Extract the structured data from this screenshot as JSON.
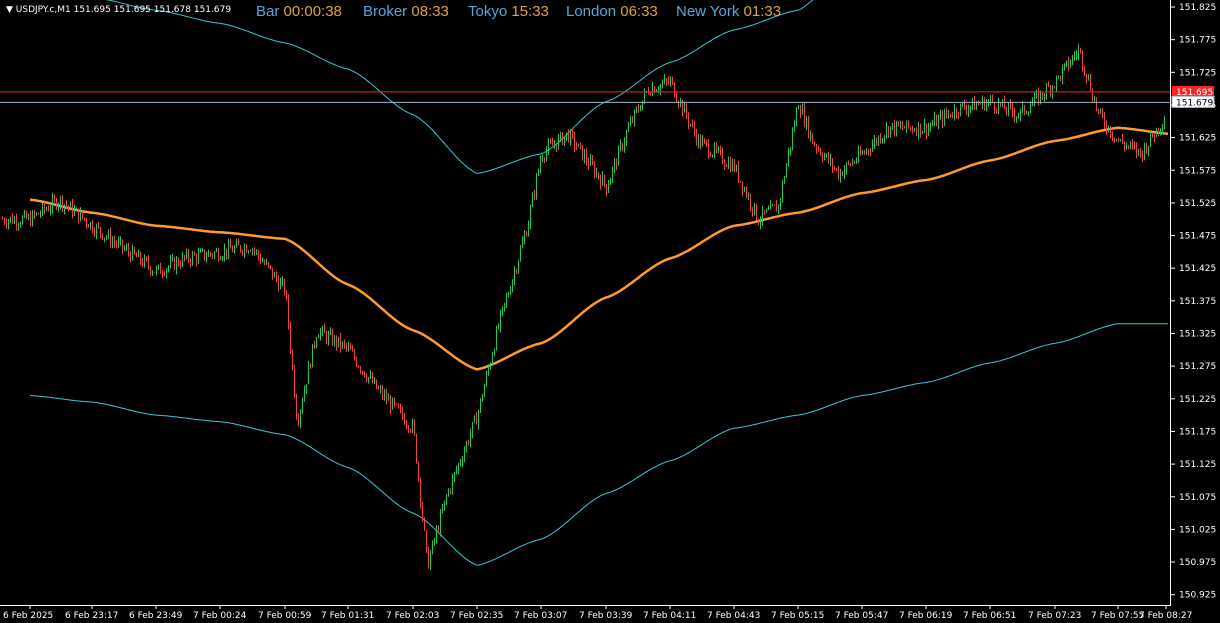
{
  "window": {
    "symbol_label": "▼ USDJPY.c,M1",
    "ohlc": "151.695 151.695 151.678 151.679"
  },
  "clocks": [
    {
      "label": "Bar",
      "value": "00:00:38"
    },
    {
      "label": "Broker",
      "value": "08:33"
    },
    {
      "label": "Tokyo",
      "value": "15:33"
    },
    {
      "label": "London",
      "value": "06:33"
    },
    {
      "label": "New York",
      "value": "01:33"
    }
  ],
  "colors": {
    "background": "#000000",
    "bull_candle": "#22c55e",
    "bear_candle": "#ef4444",
    "moving_average": "#ff9a2e",
    "bands": "#3ec6d6",
    "ask_line": "#ff2020",
    "bid_line": "#9fb8c8",
    "axis": "#ffffff"
  },
  "chart_data": {
    "type": "line",
    "instrument": "USDJPY.c",
    "timeframe": "M1",
    "y_ticks": [
      "151.825",
      "151.775",
      "151.725",
      "151.675",
      "151.625",
      "151.575",
      "151.525",
      "151.475",
      "151.425",
      "151.375",
      "151.325",
      "151.275",
      "151.225",
      "151.175",
      "151.125",
      "151.075",
      "151.025",
      "150.975",
      "150.925"
    ],
    "x_ticks": [
      "6 Feb 2025",
      "6 Feb 23:17",
      "6 Feb 23:49",
      "7 Feb 00:24",
      "7 Feb 00:59",
      "7 Feb 01:31",
      "7 Feb 02:03",
      "7 Feb 02:35",
      "7 Feb 03:07",
      "7 Feb 03:39",
      "7 Feb 04:11",
      "7 Feb 04:43",
      "7 Feb 05:15",
      "7 Feb 05:47",
      "7 Feb 06:19",
      "7 Feb 06:51",
      "7 Feb 07:23",
      "7 Feb 07:55",
      "7 Feb 08:27"
    ],
    "ylim": [
      150.92,
      151.83
    ],
    "ask_price": "151.695",
    "bid_price": "151.679",
    "series": [
      {
        "role": "price",
        "color": "#22c55e",
        "x": [
          "6 Feb 22:45",
          "6 Feb 23:00",
          "6 Feb 23:17",
          "6 Feb 23:30",
          "6 Feb 23:49",
          "7 Feb 00:05",
          "7 Feb 00:24",
          "7 Feb 00:40",
          "7 Feb 00:59",
          "7 Feb 01:05",
          "7 Feb 01:15",
          "7 Feb 01:31",
          "7 Feb 01:45",
          "7 Feb 02:03",
          "7 Feb 02:10",
          "7 Feb 02:20",
          "7 Feb 02:35",
          "7 Feb 02:45",
          "7 Feb 03:00",
          "7 Feb 03:07",
          "7 Feb 03:20",
          "7 Feb 03:39",
          "7 Feb 03:50",
          "7 Feb 04:00",
          "7 Feb 04:11",
          "7 Feb 04:25",
          "7 Feb 04:43",
          "7 Feb 04:55",
          "7 Feb 05:05",
          "7 Feb 05:15",
          "7 Feb 05:22",
          "7 Feb 05:35",
          "7 Feb 05:47",
          "7 Feb 06:00",
          "7 Feb 06:19",
          "7 Feb 06:35",
          "7 Feb 06:51",
          "7 Feb 07:05",
          "7 Feb 07:23",
          "7 Feb 07:35",
          "7 Feb 07:45",
          "7 Feb 07:55",
          "7 Feb 08:10",
          "7 Feb 08:27",
          "7 Feb 08:33"
        ],
        "y": [
          151.5,
          151.53,
          151.49,
          151.46,
          151.42,
          151.44,
          151.45,
          151.46,
          151.39,
          151.19,
          151.33,
          151.3,
          151.24,
          151.18,
          150.97,
          151.08,
          151.2,
          151.33,
          151.49,
          151.6,
          151.63,
          151.55,
          151.64,
          151.7,
          151.71,
          151.62,
          151.58,
          151.5,
          151.52,
          151.68,
          151.62,
          151.57,
          151.6,
          151.64,
          151.64,
          151.67,
          151.68,
          151.66,
          151.71,
          151.76,
          151.66,
          151.62,
          151.6,
          151.66,
          151.679
        ]
      },
      {
        "role": "moving_average",
        "color": "#ff9a2e",
        "x": [
          "6 Feb 22:45",
          "6 Feb 23:17",
          "6 Feb 23:49",
          "7 Feb 00:24",
          "7 Feb 00:59",
          "7 Feb 01:31",
          "7 Feb 02:03",
          "7 Feb 02:35",
          "7 Feb 03:07",
          "7 Feb 03:39",
          "7 Feb 04:11",
          "7 Feb 04:43",
          "7 Feb 05:15",
          "7 Feb 05:47",
          "7 Feb 06:19",
          "7 Feb 06:51",
          "7 Feb 07:23",
          "7 Feb 07:55",
          "7 Feb 08:33"
        ],
        "y": [
          151.53,
          151.51,
          151.49,
          151.48,
          151.47,
          151.4,
          151.33,
          151.27,
          151.31,
          151.38,
          151.44,
          151.49,
          151.51,
          151.54,
          151.56,
          151.59,
          151.62,
          151.64,
          151.63
        ]
      },
      {
        "role": "upper_band",
        "color": "#3ec6d6",
        "x": [
          "6 Feb 22:45",
          "6 Feb 23:17",
          "6 Feb 23:49",
          "7 Feb 00:24",
          "7 Feb 00:59",
          "7 Feb 01:31",
          "7 Feb 02:03",
          "7 Feb 02:35",
          "7 Feb 03:07",
          "7 Feb 03:39",
          "7 Feb 04:11",
          "7 Feb 04:43",
          "7 Feb 05:15",
          "7 Feb 05:25"
        ],
        "y": [
          151.84,
          151.84,
          151.82,
          151.8,
          151.77,
          151.73,
          151.66,
          151.57,
          151.6,
          151.68,
          151.74,
          151.79,
          151.82,
          151.84
        ]
      },
      {
        "role": "lower_band",
        "color": "#3ec6d6",
        "x": [
          "6 Feb 22:45",
          "6 Feb 23:17",
          "6 Feb 23:49",
          "7 Feb 00:24",
          "7 Feb 00:59",
          "7 Feb 01:31",
          "7 Feb 02:03",
          "7 Feb 02:35",
          "7 Feb 03:07",
          "7 Feb 03:39",
          "7 Feb 04:11",
          "7 Feb 04:43",
          "7 Feb 05:15",
          "7 Feb 05:47",
          "7 Feb 06:19",
          "7 Feb 06:51",
          "7 Feb 07:23",
          "7 Feb 07:55",
          "7 Feb 08:33"
        ],
        "y": [
          151.23,
          151.22,
          151.2,
          151.19,
          151.17,
          151.12,
          151.05,
          150.97,
          151.01,
          151.08,
          151.13,
          151.18,
          151.2,
          151.23,
          151.25,
          151.28,
          151.31,
          151.34,
          151.34
        ]
      }
    ]
  }
}
